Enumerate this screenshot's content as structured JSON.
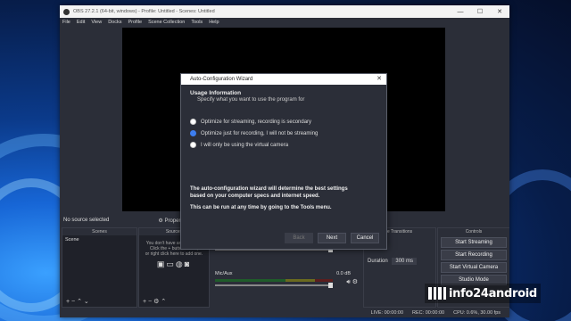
{
  "window": {
    "title": "OBS 27.2.1 (64-bit, windows) - Profile: Untitled - Scenes: Untitled",
    "controls": [
      "—",
      "☐",
      "✕"
    ]
  },
  "menu": [
    "File",
    "Edit",
    "View",
    "Docks",
    "Profile",
    "Scene Collection",
    "Tools",
    "Help"
  ],
  "source_bar": {
    "no_source": "No source selected",
    "properties": "Properties"
  },
  "docks": {
    "scenes": {
      "title": "Scenes",
      "items": [
        "Scene"
      ]
    },
    "sources": {
      "title": "Sources",
      "empty_lines": [
        "You don't have any sources.",
        "Click the + button below,",
        "or right click here to add one."
      ]
    },
    "mixer": {
      "rows": [
        {
          "name": "",
          "db": ""
        },
        {
          "name": "Mic/Aux",
          "db": "0.0 dB"
        }
      ]
    },
    "transitions": {
      "title": "e Transitions",
      "duration_label": "Duration",
      "duration_value": "300 ms"
    },
    "controls": {
      "title": "Controls",
      "buttons": [
        "Start Streaming",
        "Start Recording",
        "Start Virtual Camera",
        "Studio Mode"
      ]
    }
  },
  "status": {
    "live": "LIVE: 00:00:00",
    "rec": "REC: 00:00:00",
    "cpu": "CPU: 0.6%, 30.00 fps"
  },
  "dialog": {
    "title": "Auto-Configuration Wizard",
    "heading": "Usage Information",
    "subheading": "Specify what you want to use the program for",
    "options": [
      {
        "label": "Optimize for streaming, recording is secondary",
        "selected": false
      },
      {
        "label": "Optimize just for recording, I will not be streaming",
        "selected": true
      },
      {
        "label": "I will only be using the virtual camera",
        "selected": false
      }
    ],
    "info_line1": "The auto-configuration wizard will determine the best settings",
    "info_line2": "based on your computer specs and internet speed.",
    "info_line3": "This can be run at any time by going to the Tools menu.",
    "buttons": {
      "back": "Back",
      "next": "Next",
      "cancel": "Cancel"
    }
  },
  "watermark": "info24android"
}
